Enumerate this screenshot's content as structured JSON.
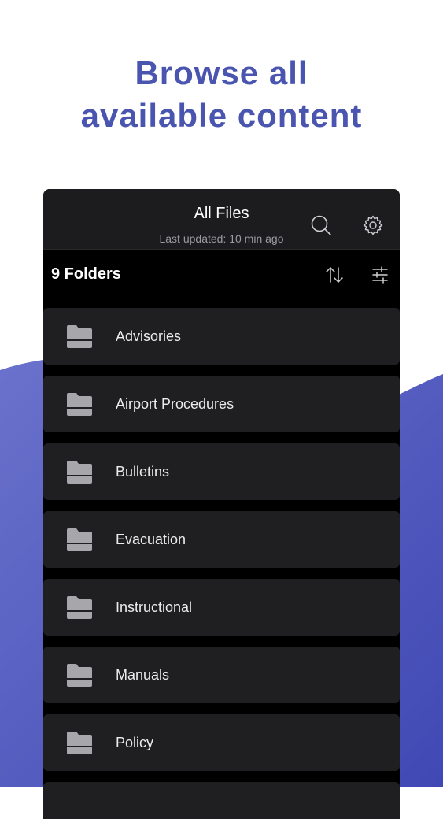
{
  "promo": {
    "headline_line1": "Browse all",
    "headline_line2": "available content",
    "accent_color": "#4a55b0"
  },
  "topbar": {
    "title": "All Files",
    "subtitle": "Last updated: 10 min ago",
    "search_icon": "search-icon",
    "settings_icon": "gear-icon"
  },
  "list_header": {
    "count_label": "9 Folders",
    "sort_icon": "sort-icon",
    "filter_icon": "sliders-icon"
  },
  "folders": [
    {
      "label": "Advisories"
    },
    {
      "label": "Airport Procedures"
    },
    {
      "label": "Bulletins"
    },
    {
      "label": "Evacuation"
    },
    {
      "label": "Instructional"
    },
    {
      "label": "Manuals"
    },
    {
      "label": "Policy"
    }
  ]
}
